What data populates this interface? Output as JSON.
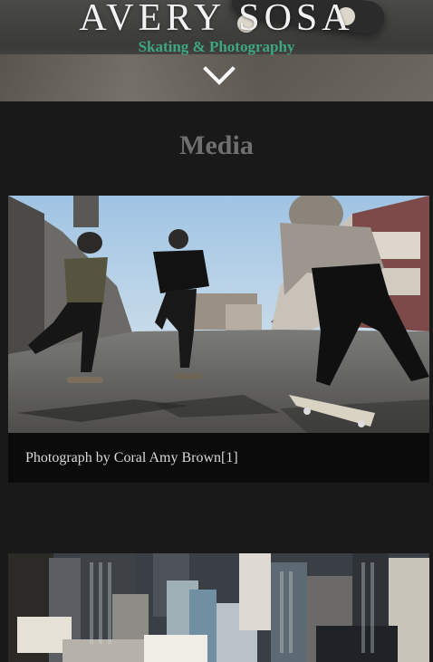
{
  "hero": {
    "title": "AVERY SOSA",
    "subtitle": "Skating & Photography",
    "scroll_icon": "chevron-down-icon"
  },
  "section": {
    "title": "Media"
  },
  "media": [
    {
      "caption": "Photograph by Coral Amy Brown[1]",
      "image": "skateboarders-street-photo"
    },
    {
      "caption": "",
      "image": "city-skyline-photo"
    }
  ],
  "colors": {
    "background": "#191919",
    "accent": "#3fa77f",
    "card": "#0b0b0b",
    "heading": "#6f6f6f"
  }
}
